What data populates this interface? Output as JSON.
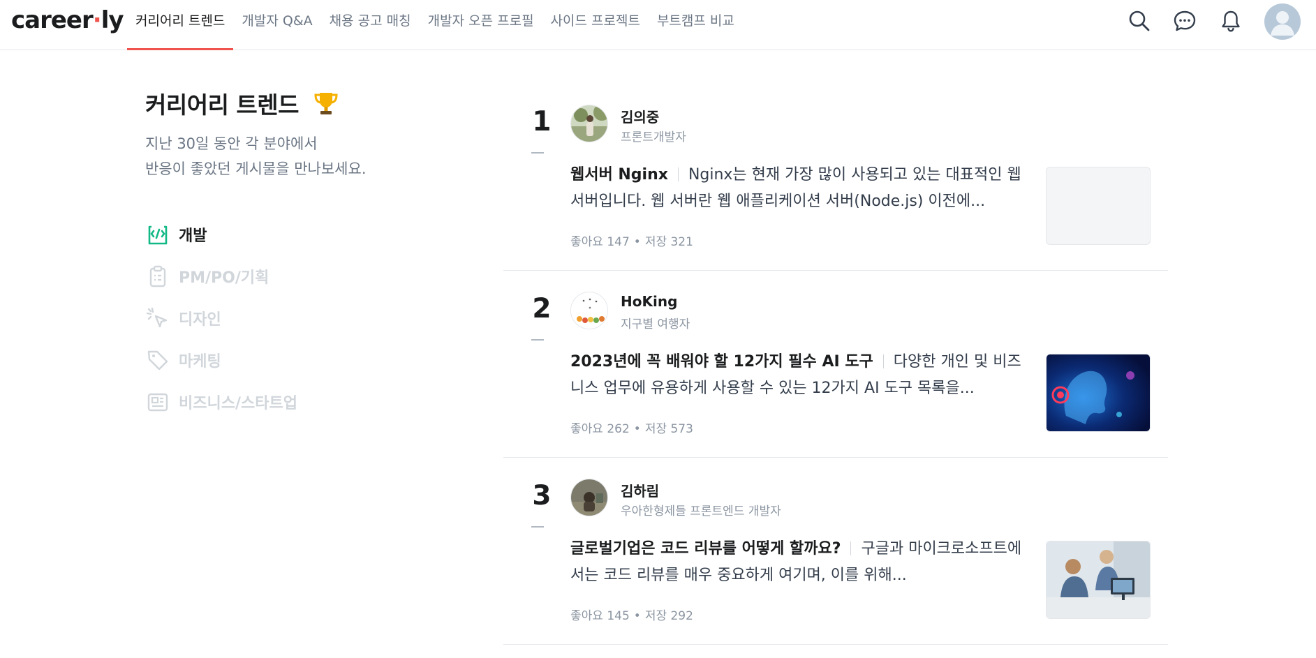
{
  "header": {
    "logo_main": "career",
    "logo_dot": "·",
    "logo_tail": "ly",
    "nav": [
      {
        "label": "커리어리 트렌드",
        "active": true
      },
      {
        "label": "개발자 Q&A"
      },
      {
        "label": "채용 공고 매칭"
      },
      {
        "label": "개발자 오픈 프로필"
      },
      {
        "label": "사이드 프로젝트"
      },
      {
        "label": "부트캠프 비교"
      }
    ],
    "icons": [
      "search-icon",
      "chat-icon",
      "bell-icon",
      "profile-avatar"
    ]
  },
  "sidebar": {
    "title": "커리어리 트렌드",
    "subtitle_line1": "지난 30일 동안 각 분야에서",
    "subtitle_line2": "반응이 좋았던 게시물을 만나보세요.",
    "categories": [
      {
        "label": "개발",
        "icon": "code-icon",
        "active": true
      },
      {
        "label": "PM/PO/기획",
        "icon": "clipboard-icon"
      },
      {
        "label": "디자인",
        "icon": "cursor-click-icon"
      },
      {
        "label": "마케팅",
        "icon": "tag-icon"
      },
      {
        "label": "비즈니스/스타트업",
        "icon": "newspaper-icon"
      }
    ]
  },
  "posts": [
    {
      "rank": "1",
      "author": "김의중",
      "role": "프론트개발자",
      "title": "웹서버 Nginx",
      "excerpt": "Nginx는 현재 가장 많이 사용되고 있는 대표적인 웹서버입니다. 웹 서버란 웹 애플리케이션 서버(Node.js) 이전에...",
      "likes_label": "좋아요 147",
      "saves_label": "저장 321"
    },
    {
      "rank": "2",
      "author": "HoKing",
      "role": "지구별 여행자",
      "title": "2023년에 꼭 배워야 할 12가지 필수 AI 도구",
      "excerpt": "다양한 개인 및 비즈니스 업무에 유용하게 사용할 수 있는 12가지 AI 도구 목록을...",
      "likes_label": "좋아요 262",
      "saves_label": "저장 573"
    },
    {
      "rank": "3",
      "author": "김하림",
      "role": "우아한형제들 프론트엔드 개발자",
      "title": "글로벌기업은 코드 리뷰를 어떻게 할까요?",
      "excerpt": "구글과 마이크로소프트에서는 코드 리뷰를 매우 중요하게 여기며, 이를 위해...",
      "likes_label": "좋아요 145",
      "saves_label": "저장 292"
    }
  ],
  "colors": {
    "accent": "#f0524d",
    "active_icon": "#12b886",
    "muted": "#8b95a1",
    "disabled": "#d1d6db"
  }
}
